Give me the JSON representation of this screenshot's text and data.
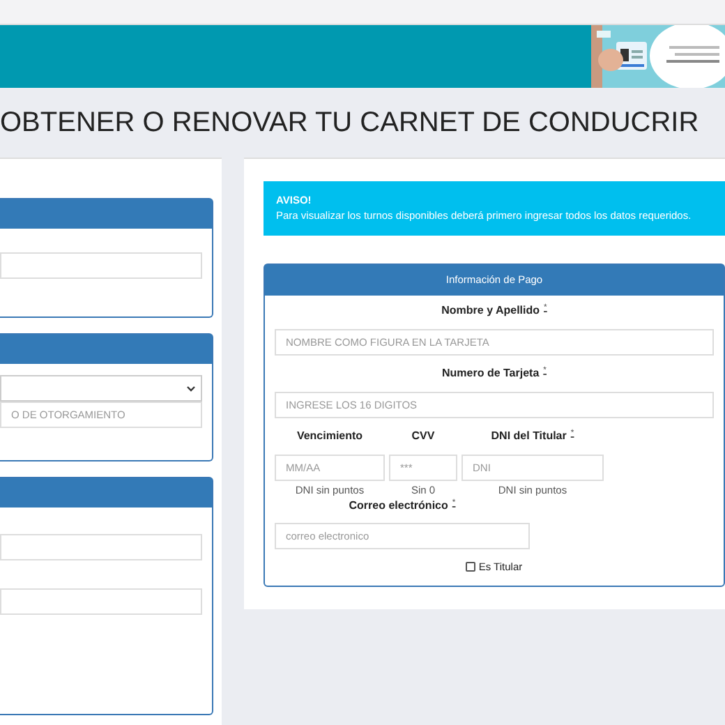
{
  "title": "OBTENER O RENOVAR TU CARNET DE CONDUCRIR",
  "left_panels": [
    {
      "fields": [
        {
          "kind": "input"
        }
      ]
    },
    {
      "fields": [
        {
          "kind": "select"
        },
        {
          "kind": "input",
          "placeholder": "O DE OTORGAMIENTO"
        }
      ]
    },
    {
      "fields": [
        {
          "kind": "input"
        },
        {
          "kind": "input"
        }
      ]
    }
  ],
  "alert": {
    "title": "AVISO!",
    "text": "Para visualizar los turnos disponibles deberá primero ingresar todos los datos requeridos."
  },
  "payment": {
    "header": "Información de Pago",
    "name": {
      "label": "Nombre y Apellido",
      "mark": "*",
      "placeholder": "NOMBRE COMO FIGURA EN LA TARJETA"
    },
    "card": {
      "label": "Numero de Tarjeta",
      "mark": "*",
      "placeholder": "INGRESE LOS 16 DIGITOS"
    },
    "row": [
      {
        "label": "Vencimiento",
        "placeholder": "MM/AA",
        "hint": "DNI sin puntos"
      },
      {
        "label": "CVV",
        "placeholder": "***",
        "hint": "Sin 0"
      },
      {
        "label": "DNI del Titular",
        "mark": "*",
        "placeholder": "DNI",
        "hint": "DNI sin puntos"
      }
    ],
    "email": {
      "label": "Correo electrónico",
      "mark": "*",
      "placeholder": "correo electronico"
    },
    "holder": {
      "label": "Es Titular",
      "checked": false
    }
  }
}
